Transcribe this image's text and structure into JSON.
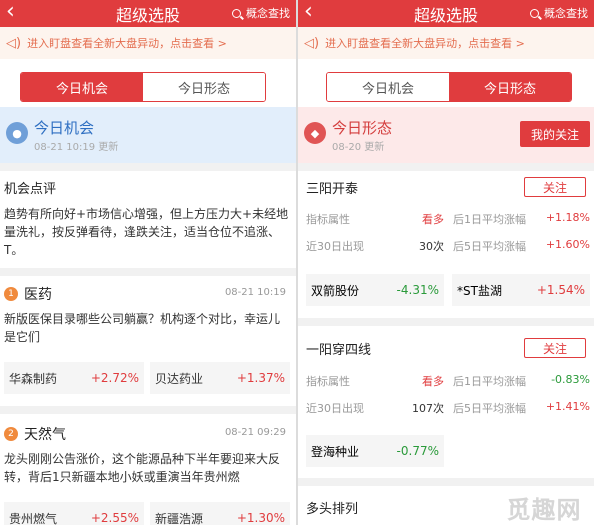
{
  "left": {
    "header": {
      "back": "‹",
      "title": "超级选股",
      "search": "概念查找"
    },
    "notice": "进入盯盘查看全新大盘异动，点击查看 >",
    "tabs": [
      "今日机会",
      "今日形态"
    ],
    "banner": {
      "title": "今日机会",
      "date": "08-21 10:19 更新"
    },
    "comment": {
      "title": "机会点评",
      "text": "趋势有所向好+市场信心增强，但上方压力大+未经地量洗礼，按反弹看待，逢跌关注，适当仓位不追涨、T。"
    },
    "news": [
      {
        "num": "1",
        "category": "医药",
        "time": "08-21 10:19",
        "text": "新版医保目录哪些公司躺赢？机构逐个对比，幸运儿是它们",
        "stocks": [
          {
            "name": "华森制药",
            "change": "+2.72%"
          },
          {
            "name": "贝达药业",
            "change": "+1.37%"
          }
        ]
      },
      {
        "num": "2",
        "category": "天然气",
        "time": "08-21 09:29",
        "text": "龙头刚刚公告涨价，这个能源品种下半年要迎来大反转，背后1只新疆本地小妖或重演当年贵州燃",
        "stocks": [
          {
            "name": "贵州燃气",
            "change": "+2.55%"
          },
          {
            "name": "新疆浩源",
            "change": "+1.30%"
          }
        ]
      }
    ]
  },
  "right": {
    "header": {
      "back": "‹",
      "title": "超级选股",
      "search": "概念查找"
    },
    "notice": "进入盯盘查看全新大盘异动，点击查看 >",
    "tabs": [
      "今日机会",
      "今日形态"
    ],
    "banner": {
      "title": "今日形态",
      "date": "08-20 更新",
      "follow": "我的关注"
    },
    "patterns": [
      {
        "name": "三阳开泰",
        "attention": "关注",
        "attr_label": "指标属性",
        "attr_value": "看多",
        "day1_label": "后1日平均涨幅",
        "day1_value": "+1.18%",
        "count_label": "近30日出现",
        "count_value": "30次",
        "day5_label": "后5日平均涨幅",
        "day5_value": "+1.60%",
        "stocks": [
          {
            "name": "双箭股份",
            "change": "-4.31%",
            "dir": "down"
          },
          {
            "name": "*ST盐湖",
            "change": "+1.54%",
            "dir": "up"
          }
        ]
      },
      {
        "name": "一阳穿四线",
        "attention": "关注",
        "attr_label": "指标属性",
        "attr_value": "看多",
        "day1_label": "后1日平均涨幅",
        "day1_value": "-0.83%",
        "count_label": "近30日出现",
        "count_value": "107次",
        "day5_label": "后5日平均涨幅",
        "day5_value": "+1.41%",
        "stocks": [
          {
            "name": "登海种业",
            "change": "-0.77%",
            "dir": "down"
          }
        ]
      },
      {
        "name": "多头排列"
      }
    ],
    "watermark": "觅趣网"
  }
}
